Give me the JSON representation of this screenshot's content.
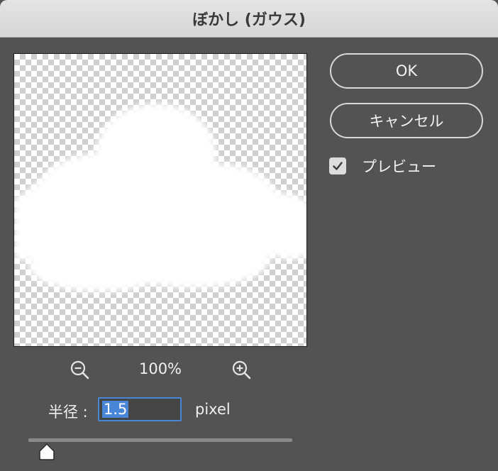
{
  "window": {
    "title": "ぼかし (ガウス)"
  },
  "preview": {
    "zoom_level": "100%"
  },
  "radius": {
    "label": "半径 :",
    "value": "1.5",
    "unit": "pixel"
  },
  "buttons": {
    "ok_label": "OK",
    "cancel_label": "キャンセル"
  },
  "preview_toggle": {
    "label": "プレビュー",
    "checked": true
  },
  "colors": {
    "accent": "#4a86d8",
    "background": "#535353",
    "titlebar": "#dcdcdc"
  },
  "icons": {
    "zoom_out": "zoom-out-icon",
    "zoom_in": "zoom-in-icon",
    "check": "checkmark-icon",
    "slider": "slider-thumb-icon"
  }
}
